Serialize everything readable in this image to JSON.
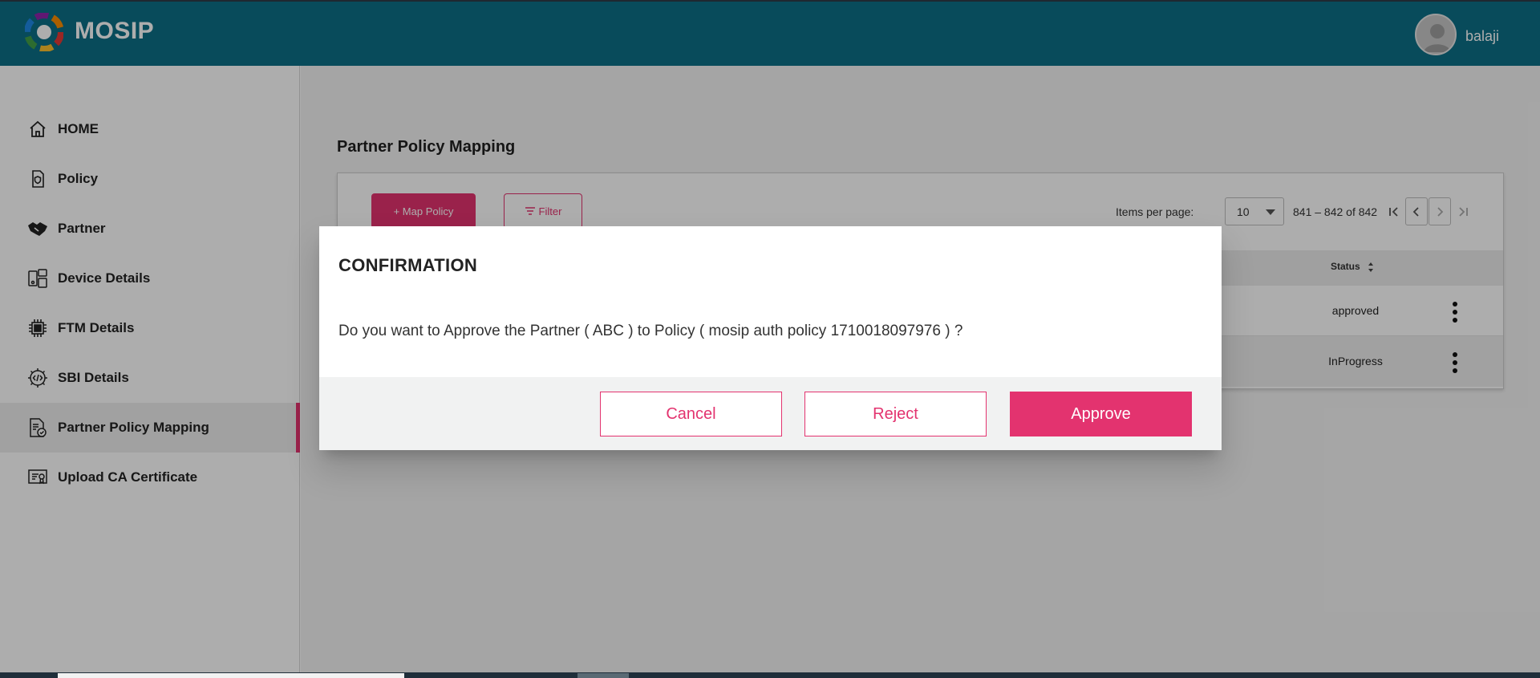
{
  "header": {
    "brand": "MOSIP",
    "logo_icon": "mosip-logo-icon",
    "username": "balaji",
    "avatar_icon": "user-avatar-icon",
    "background": "#0c6f86"
  },
  "sidebar": {
    "items": [
      {
        "label": "HOME",
        "icon": "home-icon"
      },
      {
        "label": "Policy",
        "icon": "policy-shield-icon"
      },
      {
        "label": "Partner",
        "icon": "handshake-icon"
      },
      {
        "label": "Device Details",
        "icon": "device-icon"
      },
      {
        "label": "FTM Details",
        "icon": "chip-icon"
      },
      {
        "label": "SBI Details",
        "icon": "code-gear-icon"
      },
      {
        "label": "Partner Policy Mapping",
        "icon": "mapping-document-icon",
        "active": true
      },
      {
        "label": "Upload CA Certificate",
        "icon": "certificate-icon"
      }
    ],
    "active_accent": "#e3336f"
  },
  "main": {
    "page_title": "Partner Policy Mapping",
    "toolbar": {
      "map_policy_label": "+ Map Policy",
      "filter_label": "Filter",
      "items_per_page_label": "Items per page:",
      "items_per_page_value": "10",
      "range_label": "841 – 842 of 842"
    },
    "table": {
      "columns": [
        "Status"
      ],
      "rows": [
        {
          "status": "approved"
        },
        {
          "status": "InProgress"
        }
      ]
    }
  },
  "dialog": {
    "title": "CONFIRMATION",
    "message": "Do you want to Approve the Partner ( ABC ) to Policy ( mosip auth policy 1710018097976 ) ?",
    "buttons": {
      "cancel": "Cancel",
      "reject": "Reject",
      "approve": "Approve"
    }
  },
  "colors": {
    "accent": "#e3336f",
    "header": "#0c6f86"
  }
}
